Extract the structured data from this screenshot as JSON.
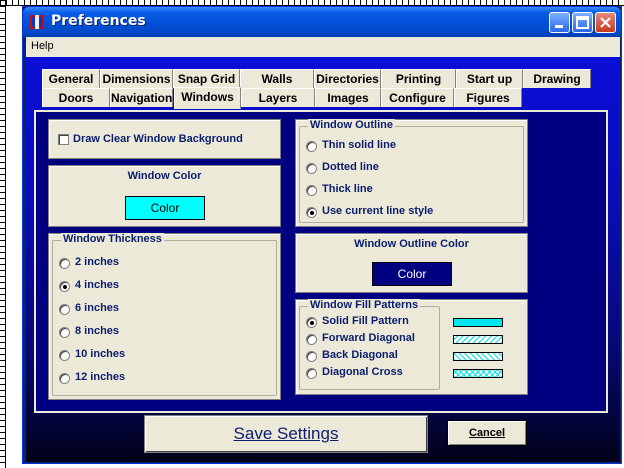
{
  "window": {
    "title": "Preferences"
  },
  "menu": {
    "help": "Help"
  },
  "tabs_row1": [
    "General",
    "Dimensions",
    "Snap Grid",
    "Walls",
    "Directories",
    "Printing",
    "Start up",
    "Drawing"
  ],
  "tabs_row2": [
    "Doors",
    "Navigation",
    "Windows",
    "Layers",
    "Images",
    "Configure",
    "Figures"
  ],
  "active_tab": "Windows",
  "draw_clear_bg": {
    "label": "Draw Clear Window Background",
    "checked": false
  },
  "window_color": {
    "heading": "Window Color",
    "button": "Color",
    "color": "#00ffff"
  },
  "window_thickness": {
    "legend": "Window Thickness",
    "options": [
      "2 inches",
      "4 inches",
      "6 inches",
      "8 inches",
      "10 inches",
      "12 inches"
    ],
    "selected": "4 inches"
  },
  "window_outline": {
    "legend": "Window Outline",
    "options": [
      "Thin solid line",
      "Dotted line",
      "Thick line",
      "Use current line style"
    ],
    "selected": "Use current line style"
  },
  "outline_color": {
    "heading": "Window Outline Color",
    "button": "Color",
    "color": "#000080"
  },
  "fill_patterns": {
    "legend": "Window Fill Patterns",
    "options": [
      "Solid Fill Pattern",
      "Forward Diagonal",
      "Back Diagonal",
      "Diagonal Cross"
    ],
    "selected": "Solid Fill Pattern",
    "swatch_color": "#00e5ee"
  },
  "buttons": {
    "save": "Save Settings",
    "cancel": "Cancel"
  }
}
